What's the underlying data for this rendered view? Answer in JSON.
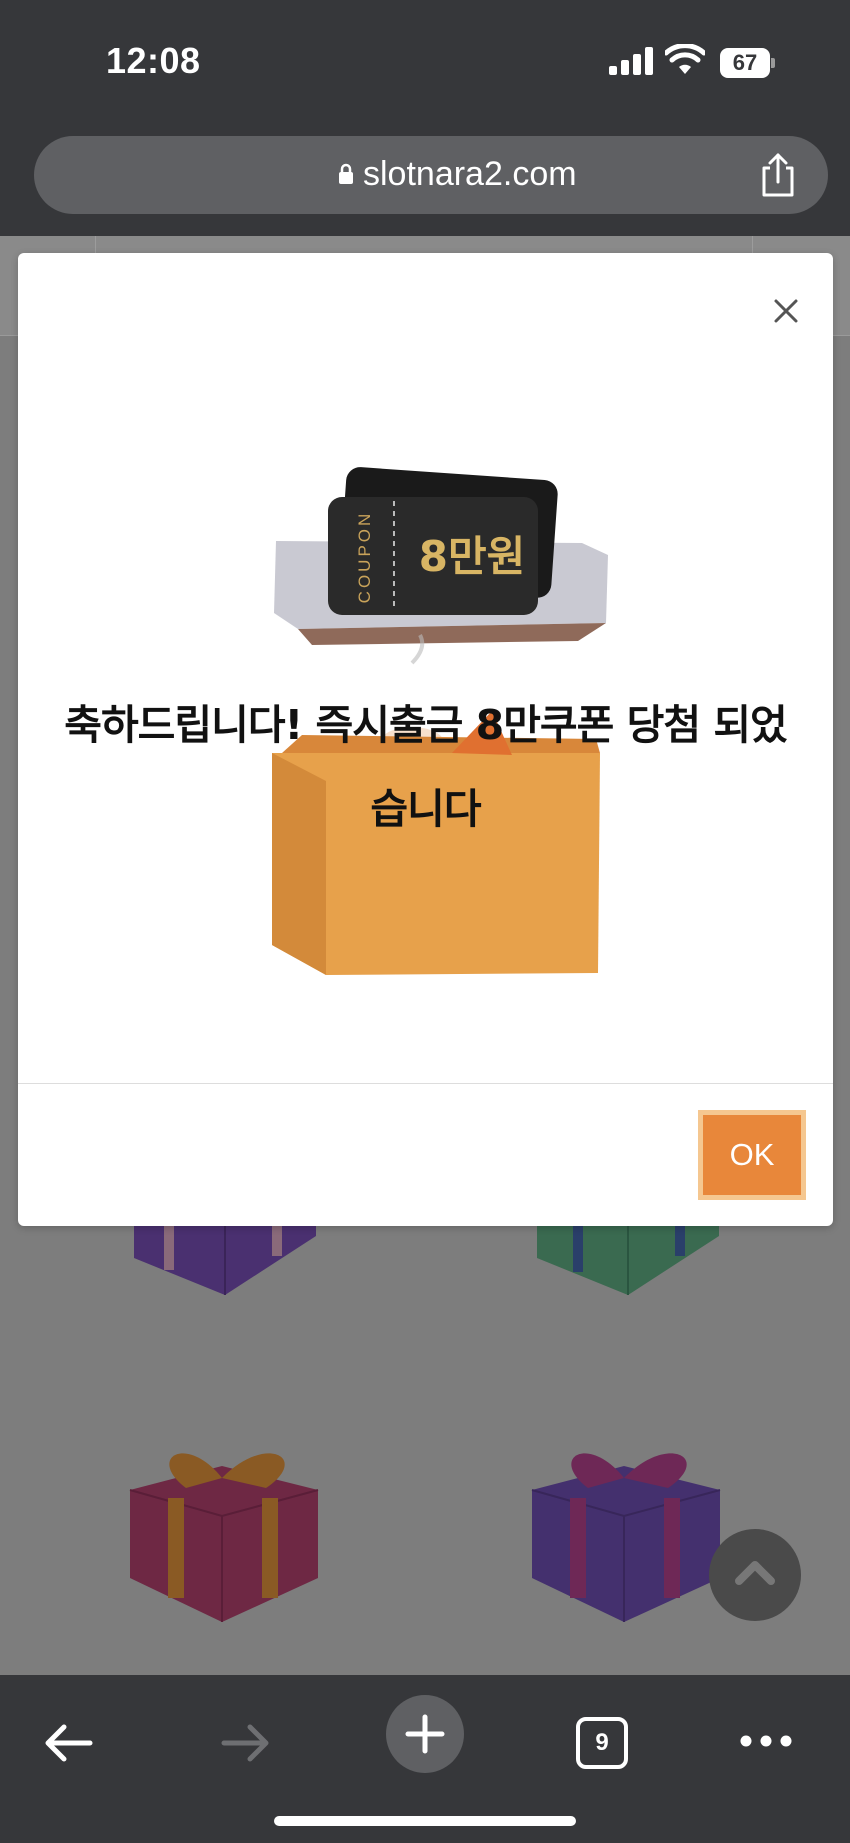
{
  "status_bar": {
    "time": "12:08",
    "battery_level": "67",
    "icons": [
      "signal-icon",
      "wifi-icon",
      "battery-icon"
    ]
  },
  "browser": {
    "url": "slotnara2.com",
    "icons": [
      "lock-icon",
      "share-icon"
    ]
  },
  "modal": {
    "image_text": {
      "coupon_label": "COUPON",
      "coupon_amount": "8만원"
    },
    "message_line1": "축하드립니다! 즉시출금 8만쿠폰 당첨 되었",
    "message_line2": "습니다",
    "ok_label": "OK",
    "close_icon": "close-icon",
    "colors": {
      "ok_button": "#e8873a",
      "ok_border": "#f5c790"
    }
  },
  "toolbar": {
    "icons": [
      "back-arrow-icon",
      "forward-arrow-icon",
      "new-tab-plus-icon",
      "tabs-icon",
      "more-icon"
    ],
    "tab_count": "9"
  },
  "colors": {
    "chrome_bg": "#36373a",
    "overlay_page": "#7d7d7d"
  }
}
